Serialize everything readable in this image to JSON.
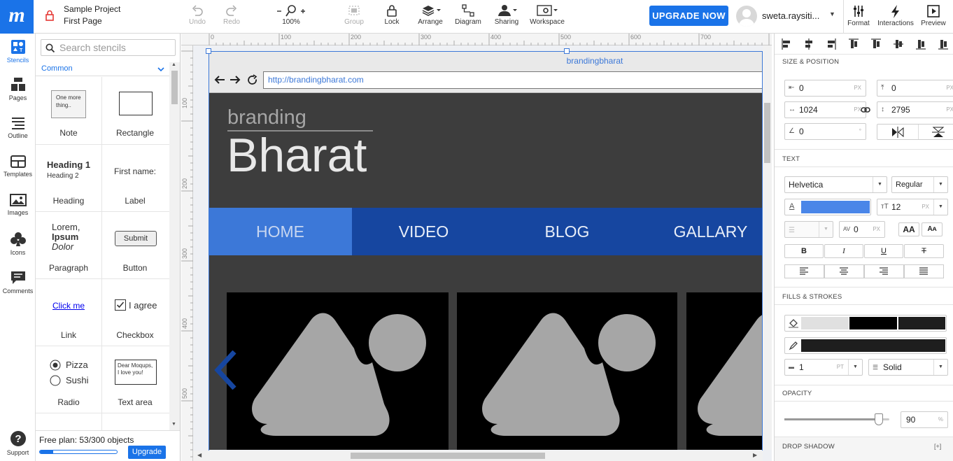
{
  "project": {
    "name": "Sample Project",
    "page": "First Page"
  },
  "toolbar": {
    "undo": "Undo",
    "redo": "Redo",
    "zoom": "100%",
    "group": "Group",
    "lock": "Lock",
    "arrange": "Arrange",
    "diagram": "Diagram",
    "sharing": "Sharing",
    "workspace": "Workspace",
    "upgrade_now": "UPGRADE NOW",
    "username": "sweta.raysiti...",
    "format": "Format",
    "interactions": "Interactions",
    "preview": "Preview"
  },
  "leftnav": {
    "stencils": "Stencils",
    "pages": "Pages",
    "outline": "Outline",
    "templates": "Templates",
    "images": "Images",
    "icons": "Icons",
    "comments": "Comments",
    "support": "Support"
  },
  "stencils": {
    "search_placeholder": "Search stencils",
    "category": "Common",
    "note_text": "One more thing..",
    "heading1": "Heading 1",
    "heading2": "Heading 2",
    "label_sample": "First name:",
    "para_l1": "Lorem,",
    "para_l2": "Ipsum",
    "para_l3": "Dolor",
    "button_sample": "Submit",
    "link_sample": "Click me",
    "checkbox_sample": "I agree",
    "radio1": "Pizza",
    "radio2": "Sushi",
    "textarea_sample": "Dear Moqups, I love you!",
    "items": [
      "Note",
      "Rectangle",
      "Heading",
      "Label",
      "Paragraph",
      "Button",
      "Link",
      "Checkbox",
      "Radio",
      "Text area"
    ]
  },
  "plan": {
    "text": "Free plan: 53/300 objects",
    "progress": 0.177,
    "upgrade": "Upgrade"
  },
  "ruler": {
    "h": [
      "0",
      "100",
      "200",
      "300",
      "400",
      "500",
      "600",
      "700"
    ],
    "v": [
      "100",
      "200",
      "300",
      "400",
      "500"
    ]
  },
  "mockup": {
    "tab_title": "brandingbharat",
    "url": "http://brandingbharat.com",
    "logo_small": "branding",
    "logo_big": "Bharat",
    "nav": [
      "HOME",
      "VIDEO",
      "BLOG",
      "GALLARY"
    ]
  },
  "panel": {
    "size_position": "SIZE & POSITION",
    "x": "0",
    "y": "0",
    "w": "1024",
    "h": "2795",
    "rotation": "0",
    "unit_px": "PX",
    "unit_deg": "°",
    "text": "TEXT",
    "font": "Helvetica",
    "weight": "Regular",
    "font_size": "12",
    "letter_spacing": "0",
    "text_color": "#4a86e8",
    "bold": "B",
    "italic": "I",
    "underline": "U",
    "strike": "T",
    "fills_strokes": "FILLS & STROKES",
    "stroke_width": "1",
    "unit_pt": "PT",
    "stroke_style": "Solid",
    "opacity": "OPACITY",
    "opacity_value": "90",
    "unit_pct": "%",
    "drop_shadow": "DROP SHADOW",
    "add": "[+]"
  },
  "colors": {
    "brand": "#1a73e8",
    "nav_bg": "#1646a0",
    "nav_active": "#3c78d8",
    "header_bg": "#3d3d3d"
  }
}
